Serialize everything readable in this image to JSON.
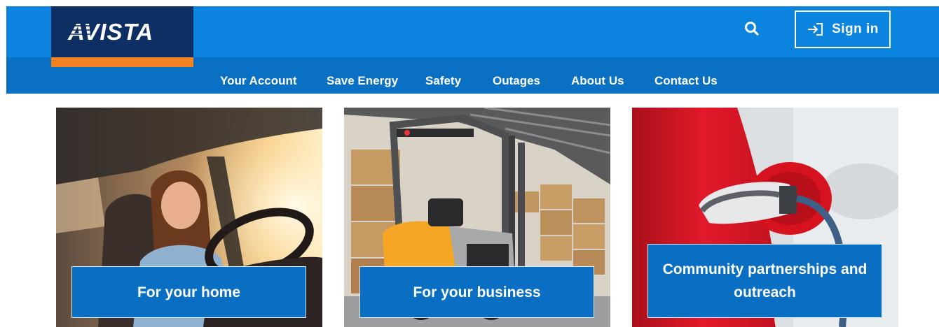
{
  "header": {
    "logo_text": "AVISTA",
    "search_icon": "search-icon",
    "signin_icon": "sign-in-arrow-icon",
    "signin_label": "Sign in",
    "colors": {
      "top_bar": "#0a84de",
      "nav_bar": "#0a70c4",
      "logo_bg": "#0e2f63",
      "logo_accent": "#f58220"
    }
  },
  "nav": {
    "items": [
      {
        "label": "Your Account"
      },
      {
        "label": "Save Energy"
      },
      {
        "label": "Safety"
      },
      {
        "label": "Outages"
      },
      {
        "label": "About Us"
      },
      {
        "label": "Contact Us"
      }
    ]
  },
  "cards": [
    {
      "label": "For your home",
      "image": "woman-driving-car-photo"
    },
    {
      "label": "For your business",
      "image": "forklift-warehouse-photo"
    },
    {
      "label": "Community partnerships and outreach",
      "image": "ev-charging-plug-photo"
    }
  ]
}
